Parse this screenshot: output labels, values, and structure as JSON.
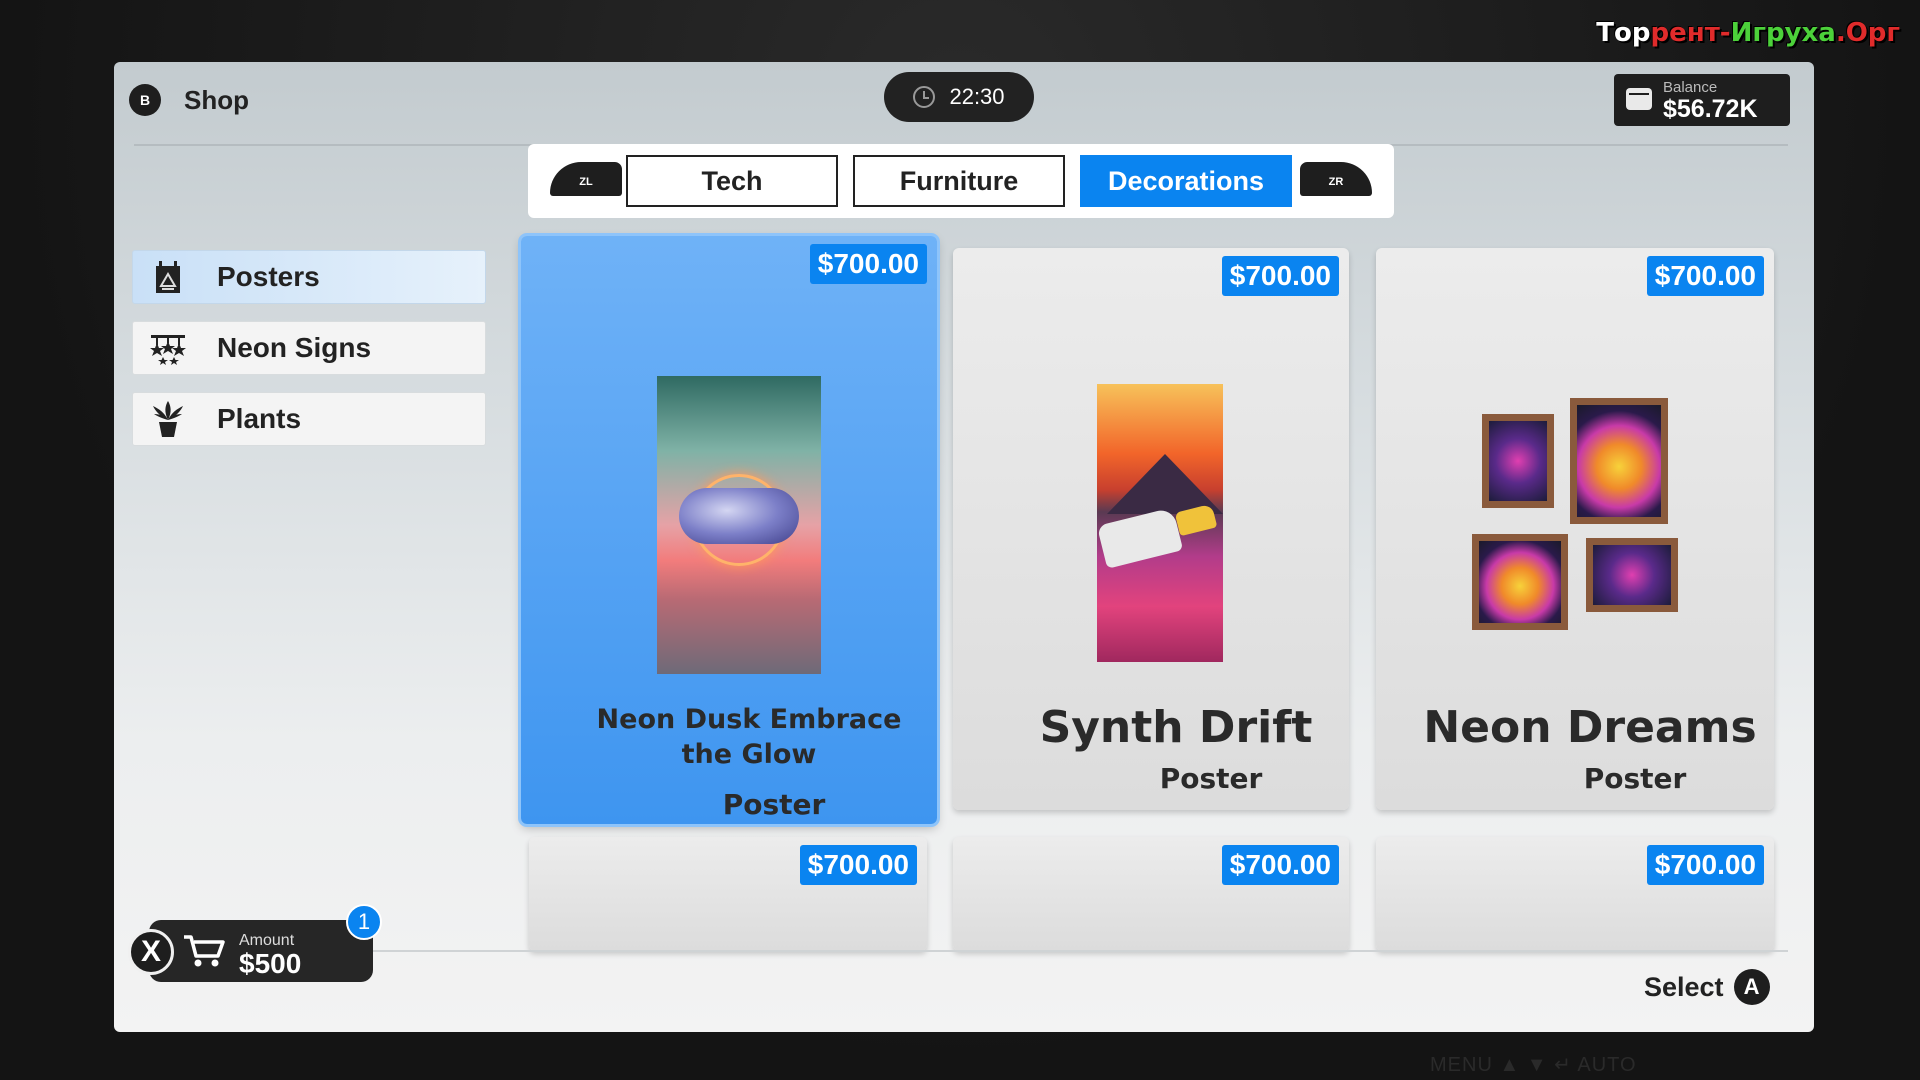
{
  "watermark": {
    "part1": "Тор",
    "part2": "рент-",
    "part3": "Игруха",
    "part4": ".Орг"
  },
  "header": {
    "back_button": "B",
    "title": "Shop",
    "time": "22:30",
    "balance_label": "Balance",
    "balance_value": "$56.72K"
  },
  "tabs": {
    "left_bumper": "ZL",
    "right_bumper": "ZR",
    "items": [
      {
        "label": "Tech",
        "active": false
      },
      {
        "label": "Furniture",
        "active": false
      },
      {
        "label": "Decorations",
        "active": true
      }
    ]
  },
  "sidebar": {
    "items": [
      {
        "label": "Posters",
        "icon": "poster-icon",
        "active": true
      },
      {
        "label": "Neon Signs",
        "icon": "neon-sign-icon",
        "active": false
      },
      {
        "label": "Plants",
        "icon": "plant-icon",
        "active": false
      }
    ]
  },
  "products": [
    {
      "price": "$700.00",
      "name_line1": "Neon Dusk Embrace",
      "name_line2": "the Glow",
      "type": "Poster",
      "selected": true
    },
    {
      "price": "$700.00",
      "name": "Synth Drift",
      "type": "Poster",
      "selected": false
    },
    {
      "price": "$700.00",
      "name": "Neon Dreams",
      "type": "Poster",
      "selected": false
    },
    {
      "price": "$700.00"
    },
    {
      "price": "$700.00"
    },
    {
      "price": "$700.00"
    }
  ],
  "cart": {
    "button": "X",
    "label": "Amount",
    "value": "$500",
    "count": "1"
  },
  "footer": {
    "select_label": "Select",
    "select_button": "A",
    "hud": "MENU   ▲   ▼   ↵   AUTO"
  },
  "colors": {
    "accent": "#0a84f0",
    "dark": "#1e1e1e"
  }
}
